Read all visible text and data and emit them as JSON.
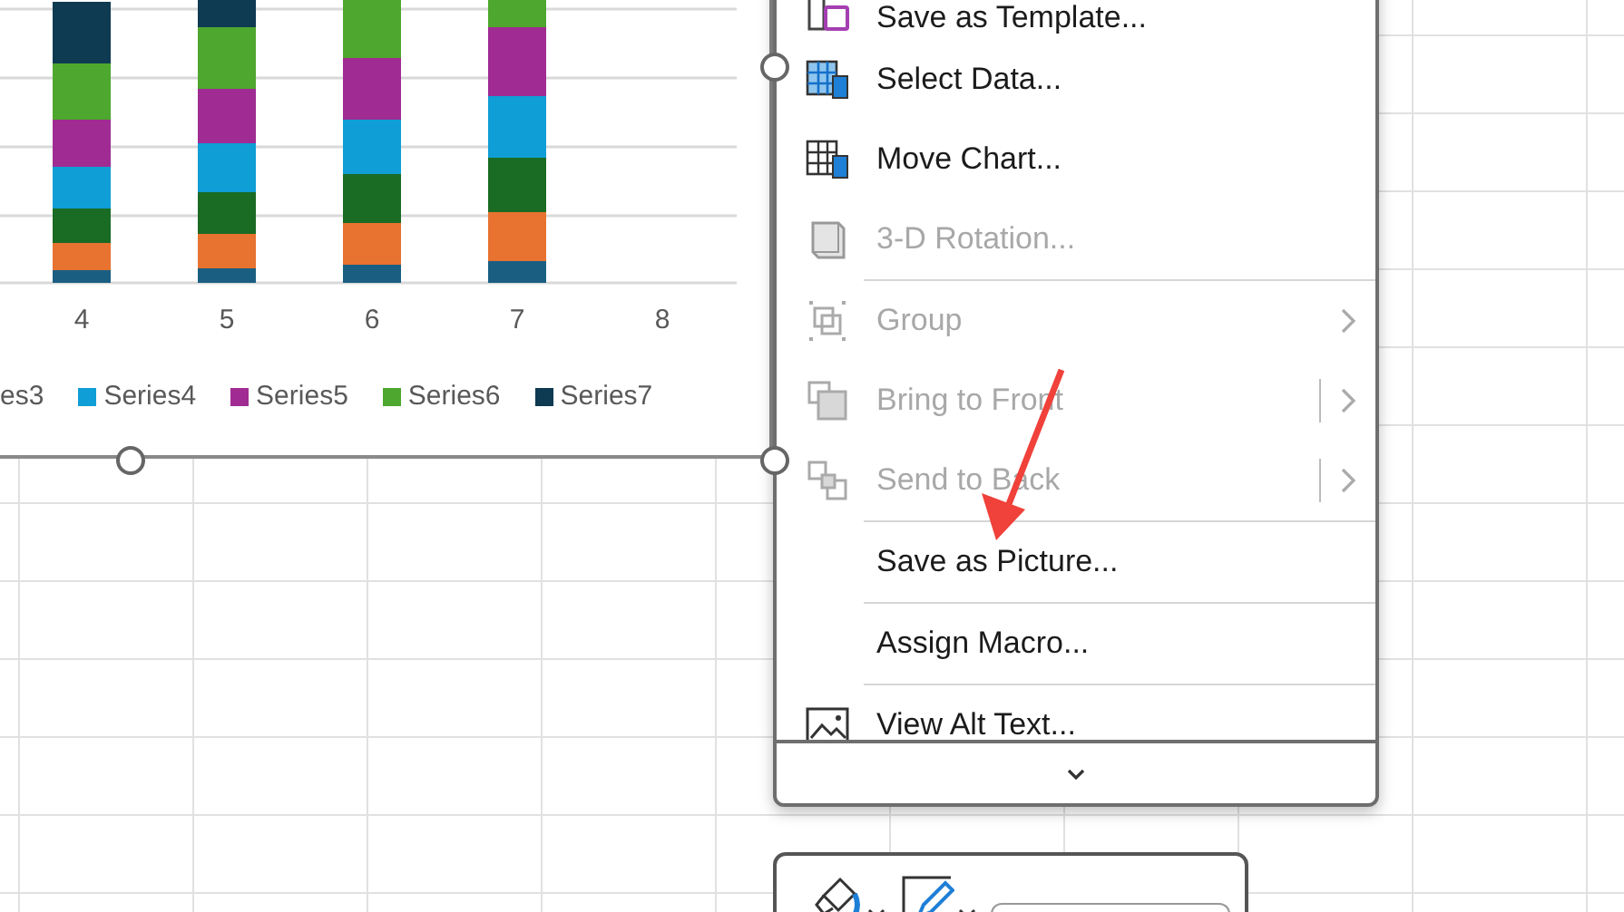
{
  "chart": {
    "categories": [
      "4",
      "5",
      "6",
      "7",
      "8"
    ],
    "legend": [
      {
        "label": "es3"
      },
      {
        "label": "Series4",
        "color": "#0f9ed5"
      },
      {
        "label": "Series5",
        "color": "#a02b93"
      },
      {
        "label": "Series6",
        "color": "#4ea72e"
      },
      {
        "label": "Series7",
        "color": "#0e3a52"
      }
    ]
  },
  "context_menu": {
    "items": [
      {
        "label": "Save as Template...",
        "disabled": false,
        "has_submenu": false,
        "split": false,
        "separator_before": false
      },
      {
        "label": "Select Data...",
        "disabled": false,
        "has_submenu": false,
        "split": false,
        "separator_before": false
      },
      {
        "label": "Move Chart...",
        "disabled": false,
        "has_submenu": false,
        "split": false,
        "separator_before": false
      },
      {
        "label": "3-D Rotation...",
        "disabled": true,
        "has_submenu": false,
        "split": false,
        "separator_before": false
      },
      {
        "label": "Group",
        "disabled": true,
        "has_submenu": true,
        "split": false,
        "separator_before": true
      },
      {
        "label": "Bring to Front",
        "disabled": true,
        "has_submenu": true,
        "split": true,
        "separator_before": false
      },
      {
        "label": "Send to Back",
        "disabled": true,
        "has_submenu": true,
        "split": true,
        "separator_before": false
      },
      {
        "label": "Save as Picture...",
        "disabled": false,
        "has_submenu": false,
        "split": false,
        "separator_before": true
      },
      {
        "label": "Assign Macro...",
        "disabled": false,
        "has_submenu": false,
        "split": false,
        "separator_before": true
      },
      {
        "label": "View Alt Text...",
        "disabled": false,
        "has_submenu": false,
        "split": false,
        "separator_before": true
      }
    ]
  }
}
